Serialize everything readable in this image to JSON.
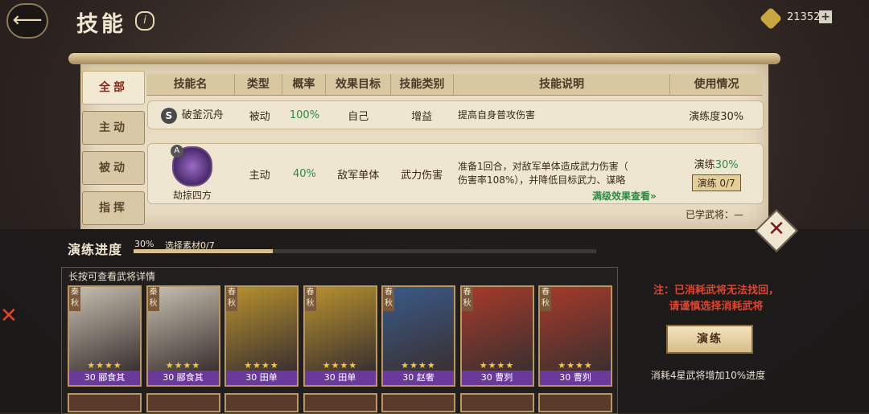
{
  "header": {
    "title": "技能",
    "help_icon": "i",
    "currency_value": "21352",
    "currency_plus": "+"
  },
  "side_tabs": [
    {
      "label": "全部",
      "active": true
    },
    {
      "label": "主动",
      "active": false
    },
    {
      "label": "被动",
      "active": false
    },
    {
      "label": "指挥",
      "active": false
    }
  ],
  "table": {
    "headers": [
      "技能名",
      "类型",
      "概率",
      "效果目标",
      "技能类别",
      "技能说明",
      "使用情况"
    ],
    "rows": [
      {
        "grade": "S",
        "name": "破釜沉舟",
        "type": "被动",
        "rate": "100%",
        "target": "自己",
        "category": "增益",
        "desc": "提高自身普攻伤害",
        "usage": "演练度30%"
      },
      {
        "grade": "A",
        "name": "劫掠四方",
        "type": "主动",
        "rate": "40%",
        "target": "敌军单体",
        "category": "武力伤害",
        "desc_line1": "准备1回合，对敌军单体造成武力伤害（",
        "desc_line2": "伤害率108%），并降低目标武力、谋略",
        "usage_label": "演练",
        "usage_pct": "30%",
        "drill_count": "演练 0/7"
      }
    ],
    "max_effect_link": "满级效果查看»",
    "learned_label": "已学武将：—"
  },
  "drill": {
    "title": "演练进度",
    "percent": "30%",
    "selection": "选择素材0/7",
    "progress": 0.3,
    "hint": "长按可查看武将详情",
    "note_line1": "注：已消耗武将无法找回，",
    "note_line2": "请谨慎选择消耗武将",
    "button_label": "演练",
    "consume_hint": "消耗4星武将增加10%进度"
  },
  "cards": [
    {
      "level": "30",
      "name": "郦食其",
      "faction": "秦\n秋",
      "stars": "★★★★",
      "color": "#c8c0b0"
    },
    {
      "level": "30",
      "name": "郦食其",
      "faction": "秦\n秋",
      "stars": "★★★★",
      "color": "#c8c0b0"
    },
    {
      "level": "30",
      "name": "田单",
      "faction": "春\n秋",
      "stars": "★★★★",
      "color": "#b8922e"
    },
    {
      "level": "30",
      "name": "田单",
      "faction": "春\n秋",
      "stars": "★★★★",
      "color": "#b8922e"
    },
    {
      "level": "30",
      "name": "赵奢",
      "faction": "春\n秋",
      "stars": "★★★★",
      "color": "#3a5a8a"
    },
    {
      "level": "30",
      "name": "曹刿",
      "faction": "春\n秋",
      "stars": "★★★★",
      "color": "#a83a2a"
    },
    {
      "level": "30",
      "name": "曹刿",
      "faction": "春\n秋",
      "stars": "★★★★",
      "color": "#a83a2a"
    }
  ],
  "colors": {
    "accent_green": "#2d8a45",
    "warning_red": "#e0442f",
    "card_name_bg": "#6a3a9a"
  }
}
